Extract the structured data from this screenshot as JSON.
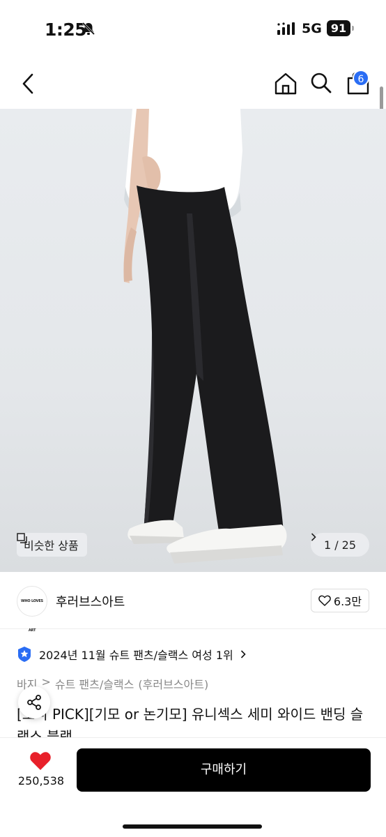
{
  "status_bar": {
    "time": "1:25",
    "network": "5G",
    "battery": "91"
  },
  "nav": {
    "cart_count": "6",
    "icons": [
      "back-icon",
      "home-icon",
      "search-icon",
      "cart-icon"
    ]
  },
  "gallery": {
    "similar_label": "비슷한 상품",
    "pager_text": "1 / 25"
  },
  "brand": {
    "logo_text": "WHO LOVES ART",
    "name": "후러브스아트",
    "likes": "6.3만"
  },
  "ranking": {
    "text": "2024년 11월 슈트 팬츠/슬랙스 여성 1위"
  },
  "breadcrumb": {
    "category": "바지",
    "subcategory": "슈트 팬츠/슬랙스",
    "brand": "(후러브스아트)"
  },
  "product": {
    "title": "[오니 PICK][기모 or 논기모] 유니섹스 세미 와이드 밴딩 슬랙스 블랙"
  },
  "bottom_bar": {
    "like_count": "250,538",
    "buy_label": "구매하기"
  },
  "colors": {
    "accent_blue": "#2a6df4",
    "heart_red": "#e8202a",
    "buy_button": "#000000"
  }
}
